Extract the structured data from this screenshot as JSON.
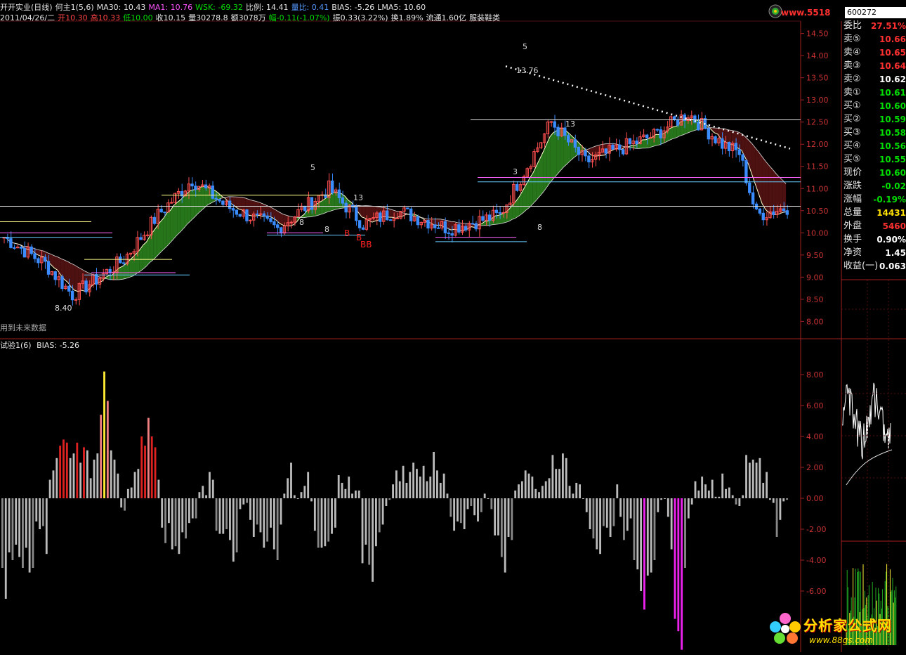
{
  "header": {
    "line1": [
      {
        "t": "开开实业(日线)",
        "c": "w"
      },
      {
        "t": "何主1(5,6)",
        "c": "w"
      },
      {
        "t": "MA30: 10.43",
        "c": "w"
      },
      {
        "t": "MA1: 10.76",
        "c": "m"
      },
      {
        "t": "WSK: -69.32",
        "c": "g"
      },
      {
        "t": "比例: 14.41",
        "c": "w"
      },
      {
        "t": "量比: 0.41",
        "c": "b"
      },
      {
        "t": "BIAS: -5.26",
        "c": "w"
      },
      {
        "t": "LMA5: 10.60",
        "c": "w"
      }
    ],
    "line2": [
      {
        "t": "2011/04/26/二",
        "c": "w"
      },
      {
        "t": "开10.30",
        "c": "r"
      },
      {
        "t": "高10.33",
        "c": "r"
      },
      {
        "t": "低10.00",
        "c": "g"
      },
      {
        "t": "收10.15",
        "c": "w"
      },
      {
        "t": "量30278.8",
        "c": "w"
      },
      {
        "t": "额3078万",
        "c": "w"
      },
      {
        "t": "幅-0.11(-1.07%)",
        "c": "g"
      },
      {
        "t": "振0.33(3.22%)",
        "c": "w"
      },
      {
        "t": "换1.89%",
        "c": "w"
      },
      {
        "t": "流通1.60亿",
        "c": "w"
      },
      {
        "t": "服装鞋类",
        "c": "w"
      }
    ]
  },
  "sub_header": {
    "name": "试验1(6)",
    "bias": "BIAS: -5.26"
  },
  "note": "用到未来数据",
  "site_tag": "www.5518",
  "code": "600272",
  "price_panel": [
    {
      "label": "委比",
      "value": "27.51%",
      "color": "#ff3030"
    },
    {
      "label": "卖⑤",
      "value": "10.66",
      "color": "#ff3030"
    },
    {
      "label": "卖④",
      "value": "10.65",
      "color": "#ff3030"
    },
    {
      "label": "卖③",
      "value": "10.64",
      "color": "#ff3030"
    },
    {
      "label": "卖②",
      "value": "10.62",
      "color": "#ffffff"
    },
    {
      "label": "卖①",
      "value": "10.61",
      "color": "#00dd00"
    },
    {
      "label": "买①",
      "value": "10.60",
      "color": "#00dd00"
    },
    {
      "label": "买②",
      "value": "10.59",
      "color": "#00dd00"
    },
    {
      "label": "买③",
      "value": "10.58",
      "color": "#00dd00"
    },
    {
      "label": "买④",
      "value": "10.56",
      "color": "#00dd00"
    },
    {
      "label": "买⑤",
      "value": "10.55",
      "color": "#00dd00"
    },
    {
      "label": "现价",
      "value": "10.60",
      "color": "#00dd00"
    },
    {
      "label": "涨跌",
      "value": "-0.02",
      "color": "#00dd00"
    },
    {
      "label": "涨幅",
      "value": "-0.19%",
      "color": "#00dd00"
    },
    {
      "label": "总量",
      "value": "14431",
      "color": "#ffe000"
    },
    {
      "label": "外盘",
      "value": "5460",
      "color": "#ff3030"
    },
    {
      "label": "换手",
      "value": "0.90%",
      "color": "#ffffff"
    },
    {
      "label": "净资",
      "value": "1.45",
      "color": "#ffffff"
    },
    {
      "label": "收益(一)",
      "value": "0.063",
      "color": "#ffffff"
    }
  ],
  "brand": {
    "name": "分析家公式网",
    "url": "www.88gs.com"
  },
  "chart_data": [
    {
      "type": "candlestick",
      "title": "开开实业(日线)",
      "ylim": [
        7.8,
        14.7
      ],
      "yticks": [
        "14.50",
        "14.00",
        "13.50",
        "13.00",
        "12.50",
        "12.00",
        "11.50",
        "11.00",
        "10.50",
        "10.00",
        "9.50",
        "9.00",
        "8.50",
        "8.00"
      ],
      "annotations": [
        "8.40",
        "13.76",
        "5",
        "13",
        "8",
        "3",
        "B",
        "BB"
      ],
      "hlines": [
        12.55,
        11.25,
        10.6,
        10.65,
        11.15
      ]
    },
    {
      "type": "bar",
      "title": "试验1(6)",
      "ylim": [
        -9.5,
        9.5
      ],
      "yticks": [
        "8.00",
        "6.00",
        "4.00",
        "2.00",
        "0.00",
        "-2.00",
        "-4.00",
        "-6.00"
      ],
      "values": [
        -4.5,
        -6.5,
        -3.5,
        -4.0,
        -3.0,
        -3.8,
        -4.5,
        -3.2,
        -4.8,
        -4.5,
        -1.5,
        -2.0,
        -1.8,
        -3.6,
        1.2,
        1.8,
        2.6,
        3.4,
        3.8,
        3.6,
        2.6,
        2.9,
        3.6,
        2.3,
        3.3,
        3.1,
        1.3,
        2.5,
        2.9,
        5.4,
        8.2,
        6.3,
        3.1,
        2.5,
        1.6,
        -0.6,
        -0.8,
        0.6,
        0.7,
        1.7,
        1.9,
        4.0,
        3.4,
        5.2,
        4.0,
        3.3,
        1.2,
        -1.9,
        -2.9,
        -1.6,
        -3.3,
        -3.1,
        -3.6,
        -2.2,
        -2.6,
        -1.6,
        -1.3,
        -1.3,
        0.4,
        0.8,
        0.2,
        1.7,
        1.2,
        -2.1,
        -2.3,
        -2.3,
        -2.0,
        -2.7,
        -4.1,
        -3.5,
        -0.7,
        -0.4,
        -0.3,
        -1.4,
        -2.5,
        -1.7,
        -2.2,
        -3.2,
        -2.8,
        -1.9,
        -3.3,
        -4.0,
        -1.7,
        0.3,
        1.3,
        2.3,
        0.2,
        0.0,
        0.4,
        0.8,
        1.7,
        -0.2,
        -2.1,
        -3.2,
        -3.2,
        -3.1,
        -2.8,
        -2.3,
        -1.9,
        1.5,
        1.0,
        0.6,
        1.4,
        0.3,
        0.5,
        0.5,
        -4.2,
        -3.0,
        -4.3,
        -5.4,
        -3.1,
        -2.2,
        -1.7,
        -0.5,
        -0.1,
        0.9,
        1.8,
        1.1,
        2.1,
        1.0,
        1.7,
        2.3,
        1.9,
        1.4,
        2.1,
        1.1,
        1.4,
        3.0,
        1.8,
        1.0,
        1.6,
        0.3,
        -1.2,
        -2.1,
        -1.5,
        -1.6,
        -2.0,
        -0.7,
        -0.5,
        -1.1,
        -1.5,
        -0.9,
        0.3,
        0.0,
        -0.7,
        -2.4,
        -2.4,
        -3.8,
        -4.8,
        -2.5,
        -2.7,
        0.5,
        0.9,
        1.1,
        1.8,
        1.6,
        1.4,
        0.6,
        0.4,
        0.8,
        1.1,
        1.3,
        2.8,
        1.9,
        1.9,
        2.9,
        2.6,
        0.8,
        0.3,
        1.0,
        0.9,
        0.0,
        -0.9,
        -2.0,
        -2.6,
        -3.3,
        -3.6,
        -1.8,
        -1.9,
        -2.5,
        -1.8,
        0.9,
        -1.2,
        -2.7,
        -2.1,
        -1.3,
        -4.0,
        -4.6,
        -6.0,
        -7.2,
        -5.0,
        -4.8,
        -4.0,
        -0.9,
        -0.1,
        0.0,
        -1.2,
        -3.3,
        -7.8,
        -8.6,
        -9.8,
        -4.5,
        -1.3,
        -0.4,
        1.1,
        0.5,
        1.4,
        0.9,
        0.5,
        1.2,
        0.1,
        0.1,
        1.6,
        0.6,
        0.7,
        0.2,
        -0.4,
        -0.5,
        0.2,
        2.8,
        2.3,
        2.5,
        2.3,
        2.6,
        1.0,
        1.7,
        -0.1,
        -0.3,
        -2.5,
        -1.4,
        -0.2,
        -0.1
      ]
    }
  ]
}
